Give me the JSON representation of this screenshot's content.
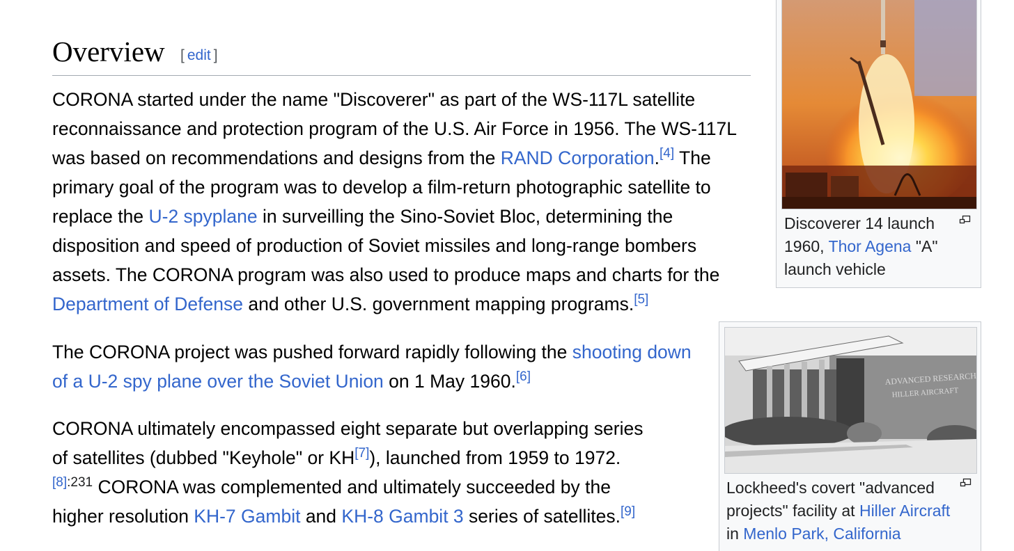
{
  "section": {
    "title": "Overview",
    "edit_open": "[",
    "edit_label": "edit",
    "edit_close": "]"
  },
  "paragraph1": {
    "t1": "CORONA started under the name \"Discoverer\" as part of the WS-117L satellite reconnaissance and protection program of the U.S. Air Force in 1956. The WS-117L was based on recommendations and designs from the ",
    "link_rand": "RAND Corporation",
    "t2": ".",
    "ref4": "[4]",
    "t3": " The primary goal of the program was to develop a film-return photographic satellite to replace the ",
    "link_u2": "U-2 spyplane",
    "t4": " in surveilling the Sino-Soviet Bloc, determining the disposition and speed of production of Soviet missiles and long-range bombers assets. The CORONA program was also used to produce maps and charts for the ",
    "link_dod": "Department of Defense",
    "t5": " and other U.S. government mapping programs.",
    "ref5": "[5]"
  },
  "paragraph2": {
    "t1": "The CORONA project was pushed forward rapidly following the ",
    "link_shootdown": "shooting down of a U-2 spy plane over the Soviet Union",
    "t2": " on 1 May 1960.",
    "ref6": "[6]"
  },
  "paragraph3": {
    "t1": "CORONA ultimately encompassed eight separate but overlapping series of satellites (dubbed \"Keyhole\" or KH",
    "ref7": "[7]",
    "t2": "), launched from 1959 to 1972.",
    "ref8": "[8]",
    "ref8_page": ":231",
    "t3": " CORONA was complemented and ultimately succeeded by the higher resolution ",
    "link_kh7": "KH-7 Gambit",
    "t4": " and ",
    "link_kh8": "KH-8 Gambit 3",
    "t5": " series of satellites.",
    "ref9": "[9]"
  },
  "figure1": {
    "image_label": "Discoverer 14 launch photograph",
    "caption_t1": "Discoverer 14 launch 1960, ",
    "caption_link": "Thor Agena",
    "caption_t2": " \"A\" launch vehicle",
    "icon": "magnify-icon"
  },
  "figure2": {
    "image_label": "Lockheed advanced projects facility photograph",
    "sign_line1": "ADVANCED RESEARCH",
    "sign_line2": "HILLER AIRCRAFT",
    "caption_t1": "Lockheed's covert \"advanced projects\" facility at ",
    "caption_link1": "Hiller Aircraft",
    "caption_t2": " in ",
    "caption_link2": "Menlo Park, California",
    "icon": "magnify-icon"
  },
  "colors": {
    "link": "#3366cc",
    "text": "#000000",
    "rule": "#a2a9b1",
    "thumb_bg": "#f8f9fa"
  }
}
